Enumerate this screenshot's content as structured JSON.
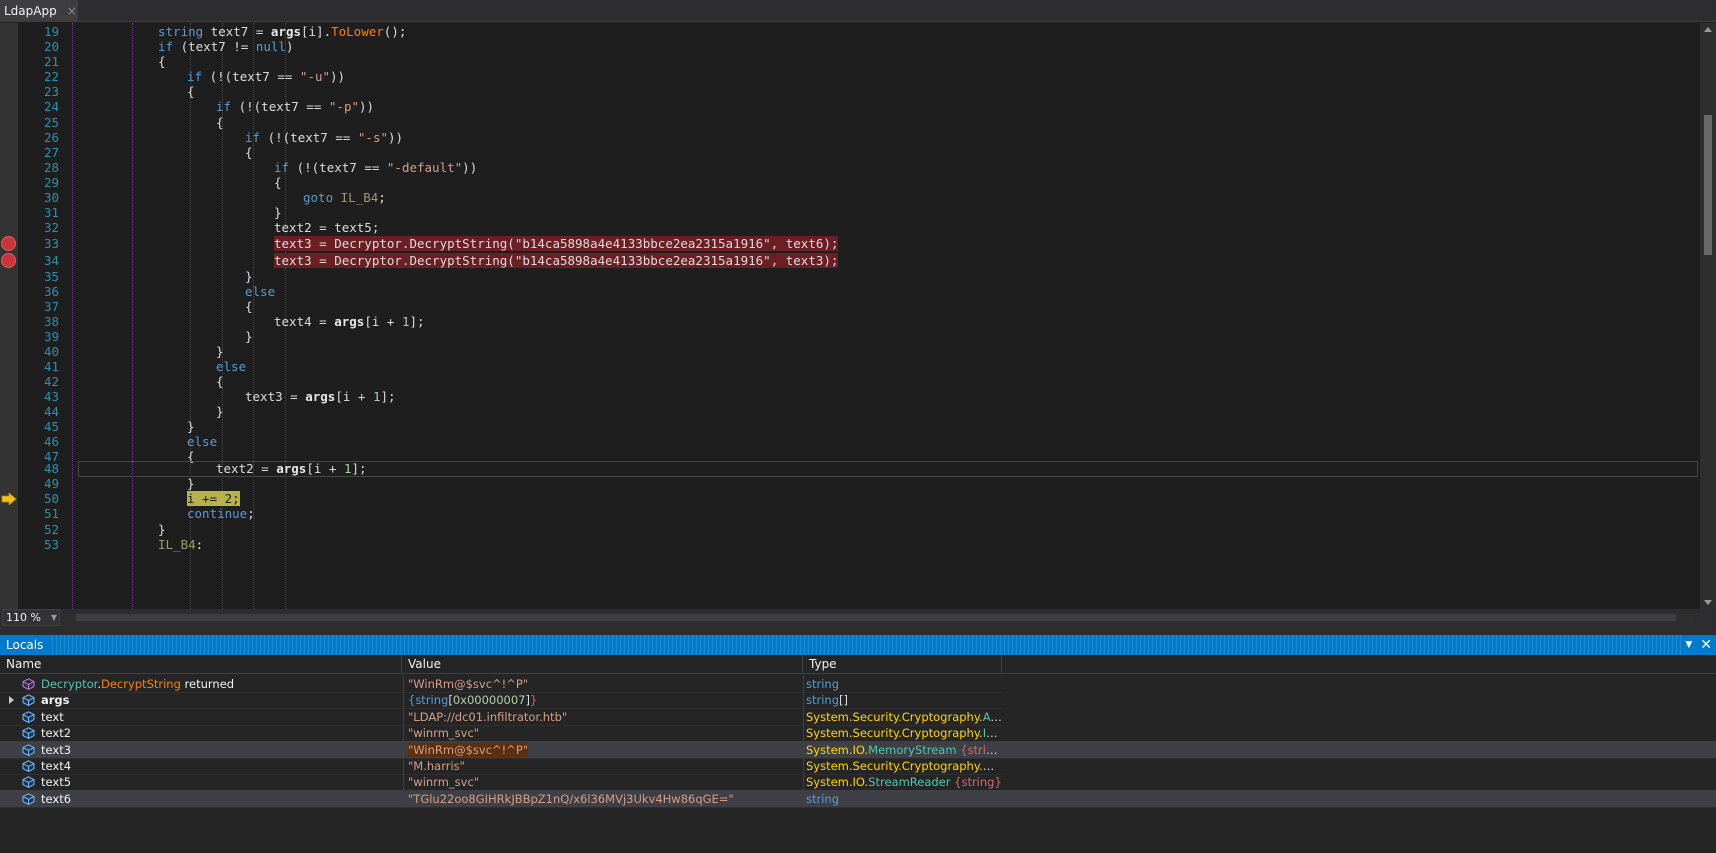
{
  "tab": {
    "title": "LdapApp",
    "close": "×"
  },
  "editor": {
    "lines": [
      {
        "no": "19",
        "indent": 3,
        "html": "<span class=\"k\">string</span> text7 = <span class=\"b\">args</span>[i].<span class=\"m\">ToLower</span>();"
      },
      {
        "no": "20",
        "indent": 3,
        "html": "<span class=\"k\">if</span> (text7 != <span class=\"k\">null</span>)"
      },
      {
        "no": "21",
        "indent": 3,
        "html": "{"
      },
      {
        "no": "22",
        "indent": 4,
        "html": "<span class=\"k\">if</span> (!(text7 == <span class=\"s\">\"-u\"</span>))"
      },
      {
        "no": "23",
        "indent": 4,
        "html": "{"
      },
      {
        "no": "24",
        "indent": 5,
        "html": "<span class=\"k\">if</span> (!(text7 == <span class=\"s\">\"-p\"</span>))"
      },
      {
        "no": "25",
        "indent": 5,
        "html": "{"
      },
      {
        "no": "26",
        "indent": 6,
        "html": "<span class=\"k\">if</span> (!(text7 == <span class=\"s\">\"-s\"</span>))"
      },
      {
        "no": "27",
        "indent": 6,
        "html": "{"
      },
      {
        "no": "28",
        "indent": 7,
        "html": "<span class=\"k\">if</span> (!(text7 == <span class=\"s\">\"-default\"</span>))"
      },
      {
        "no": "29",
        "indent": 7,
        "html": "{"
      },
      {
        "no": "30",
        "indent": 8,
        "html": "<span class=\"k\">goto</span> <span class=\"lbl\">IL_B4</span>;"
      },
      {
        "no": "31",
        "indent": 7,
        "html": "}"
      },
      {
        "no": "32",
        "indent": 7,
        "html": "text2 = text5;"
      },
      {
        "no": "33",
        "indent": 7,
        "bp": true,
        "red": true,
        "html": "text3 = Decryptor.DecryptString(\"b14ca5898a4e4133bbce2ea2315a1916\", text6);"
      },
      {
        "no": "34",
        "indent": 7,
        "bp": true,
        "red": true,
        "html": "text3 = Decryptor.DecryptString(\"b14ca5898a4e4133bbce2ea2315a1916\", text3);"
      },
      {
        "no": "35",
        "indent": 6,
        "html": "}"
      },
      {
        "no": "36",
        "indent": 6,
        "html": "<span class=\"k\">else</span>"
      },
      {
        "no": "37",
        "indent": 6,
        "html": "{"
      },
      {
        "no": "38",
        "indent": 7,
        "html": "text4 = <span class=\"b\">args</span>[i + <span class=\"n\">1</span>];"
      },
      {
        "no": "39",
        "indent": 6,
        "html": "}"
      },
      {
        "no": "40",
        "indent": 5,
        "html": "}"
      },
      {
        "no": "41",
        "indent": 5,
        "html": "<span class=\"k\">else</span>"
      },
      {
        "no": "42",
        "indent": 5,
        "html": "{"
      },
      {
        "no": "43",
        "indent": 6,
        "html": "text3 = <span class=\"b\">args</span>[i + <span class=\"n\">1</span>];"
      },
      {
        "no": "44",
        "indent": 5,
        "html": "}"
      },
      {
        "no": "45",
        "indent": 4,
        "html": "}"
      },
      {
        "no": "46",
        "indent": 4,
        "html": "<span class=\"k\">else</span>"
      },
      {
        "no": "47",
        "indent": 4,
        "html": "{"
      },
      {
        "no": "48",
        "indent": 5,
        "current": true,
        "html": "text2 = <span class=\"b\">args</span>[i + <span class=\"n\">1</span>];"
      },
      {
        "no": "49",
        "indent": 4,
        "html": "}"
      },
      {
        "no": "50",
        "indent": 4,
        "arrow": true,
        "yellow": true,
        "html": "i += 2;"
      },
      {
        "no": "51",
        "indent": 4,
        "html": "<span class=\"k\">continue</span>;"
      },
      {
        "no": "52",
        "indent": 3,
        "html": "}"
      },
      {
        "no": "53",
        "indent": 2,
        "html": "<span class=\"lbl\">IL_B4</span>:"
      }
    ]
  },
  "zoom": {
    "value": "110 %"
  },
  "locals": {
    "title": "Locals",
    "pin": "▼",
    "close": "✕",
    "columns": {
      "name": "Name",
      "value": "Value",
      "type": "Type"
    },
    "rows": [
      {
        "icon": "method-return-icon",
        "nameHtml": "<span class=\"t-cls\">Decryptor</span>.<span style=\"color:#ff8000\">DecryptString</span> returned",
        "valHtml": "\"WinRm@$svc^!^P\"",
        "typeHtml": "<span class=\"t-str\">string</span>"
      },
      {
        "icon": "field-icon",
        "expand": true,
        "nameHtml": "<b>args</b>",
        "valHtml": "<span class=\"t-str\">{string</span><span class=\"t-gray\">[</span><span class=\"v-hex\">0x00000007</span><span class=\"t-gray\">]</span><span class=\"t-red\">}</span>",
        "typeHtml": "<span class=\"t-str\">string</span>[]"
      },
      {
        "icon": "field-icon",
        "nameHtml": "text",
        "valHtml": "\"LDAP://dc01.infiltrator.htb\"",
        "typeHtml": "<span class=\"t-ns\">System.Security.Cryptography.</span><span class=\"t-cls\">Aes</span>..."
      },
      {
        "icon": "field-icon",
        "nameHtml": "text2",
        "valHtml": "\"winrm_svc\"",
        "typeHtml": "<span class=\"t-ns\">System.Security.Cryptography.</span><span class=\"t-cls\">ICr</span>..."
      },
      {
        "icon": "field-icon",
        "sel": true,
        "nameHtml": "text3",
        "valHtml": "<span class=\"v-hi\">\"WinRm@$svc^!^P\"</span>",
        "typeHtml": "<span class=\"t-ns\">System.IO.</span><span class=\"t-cls\">MemoryStream</span> <span class=\"t-red\">{string}</span>"
      },
      {
        "icon": "field-icon",
        "nameHtml": "text4",
        "valHtml": "\"M.harris\"",
        "typeHtml": "<span class=\"t-ns\">System.Security.Cryptography.</span><span class=\"t-cls\">Cry</span>..."
      },
      {
        "icon": "field-icon",
        "nameHtml": "text5",
        "valHtml": "\"winrm_svc\"",
        "typeHtml": "<span class=\"t-ns\">System.IO.</span><span class=\"t-cls\">StreamReader</span> <span class=\"t-red\">{string}</span>"
      },
      {
        "icon": "field-icon",
        "sel2": true,
        "nameHtml": "text6",
        "valHtml": "\"TGlu22oo8GIHRkJBBpZ1nQ/x6l36MVj3Ukv4Hw86qGE=\"",
        "typeHtml": "<span class=\"t-str\">string</span>"
      }
    ]
  }
}
